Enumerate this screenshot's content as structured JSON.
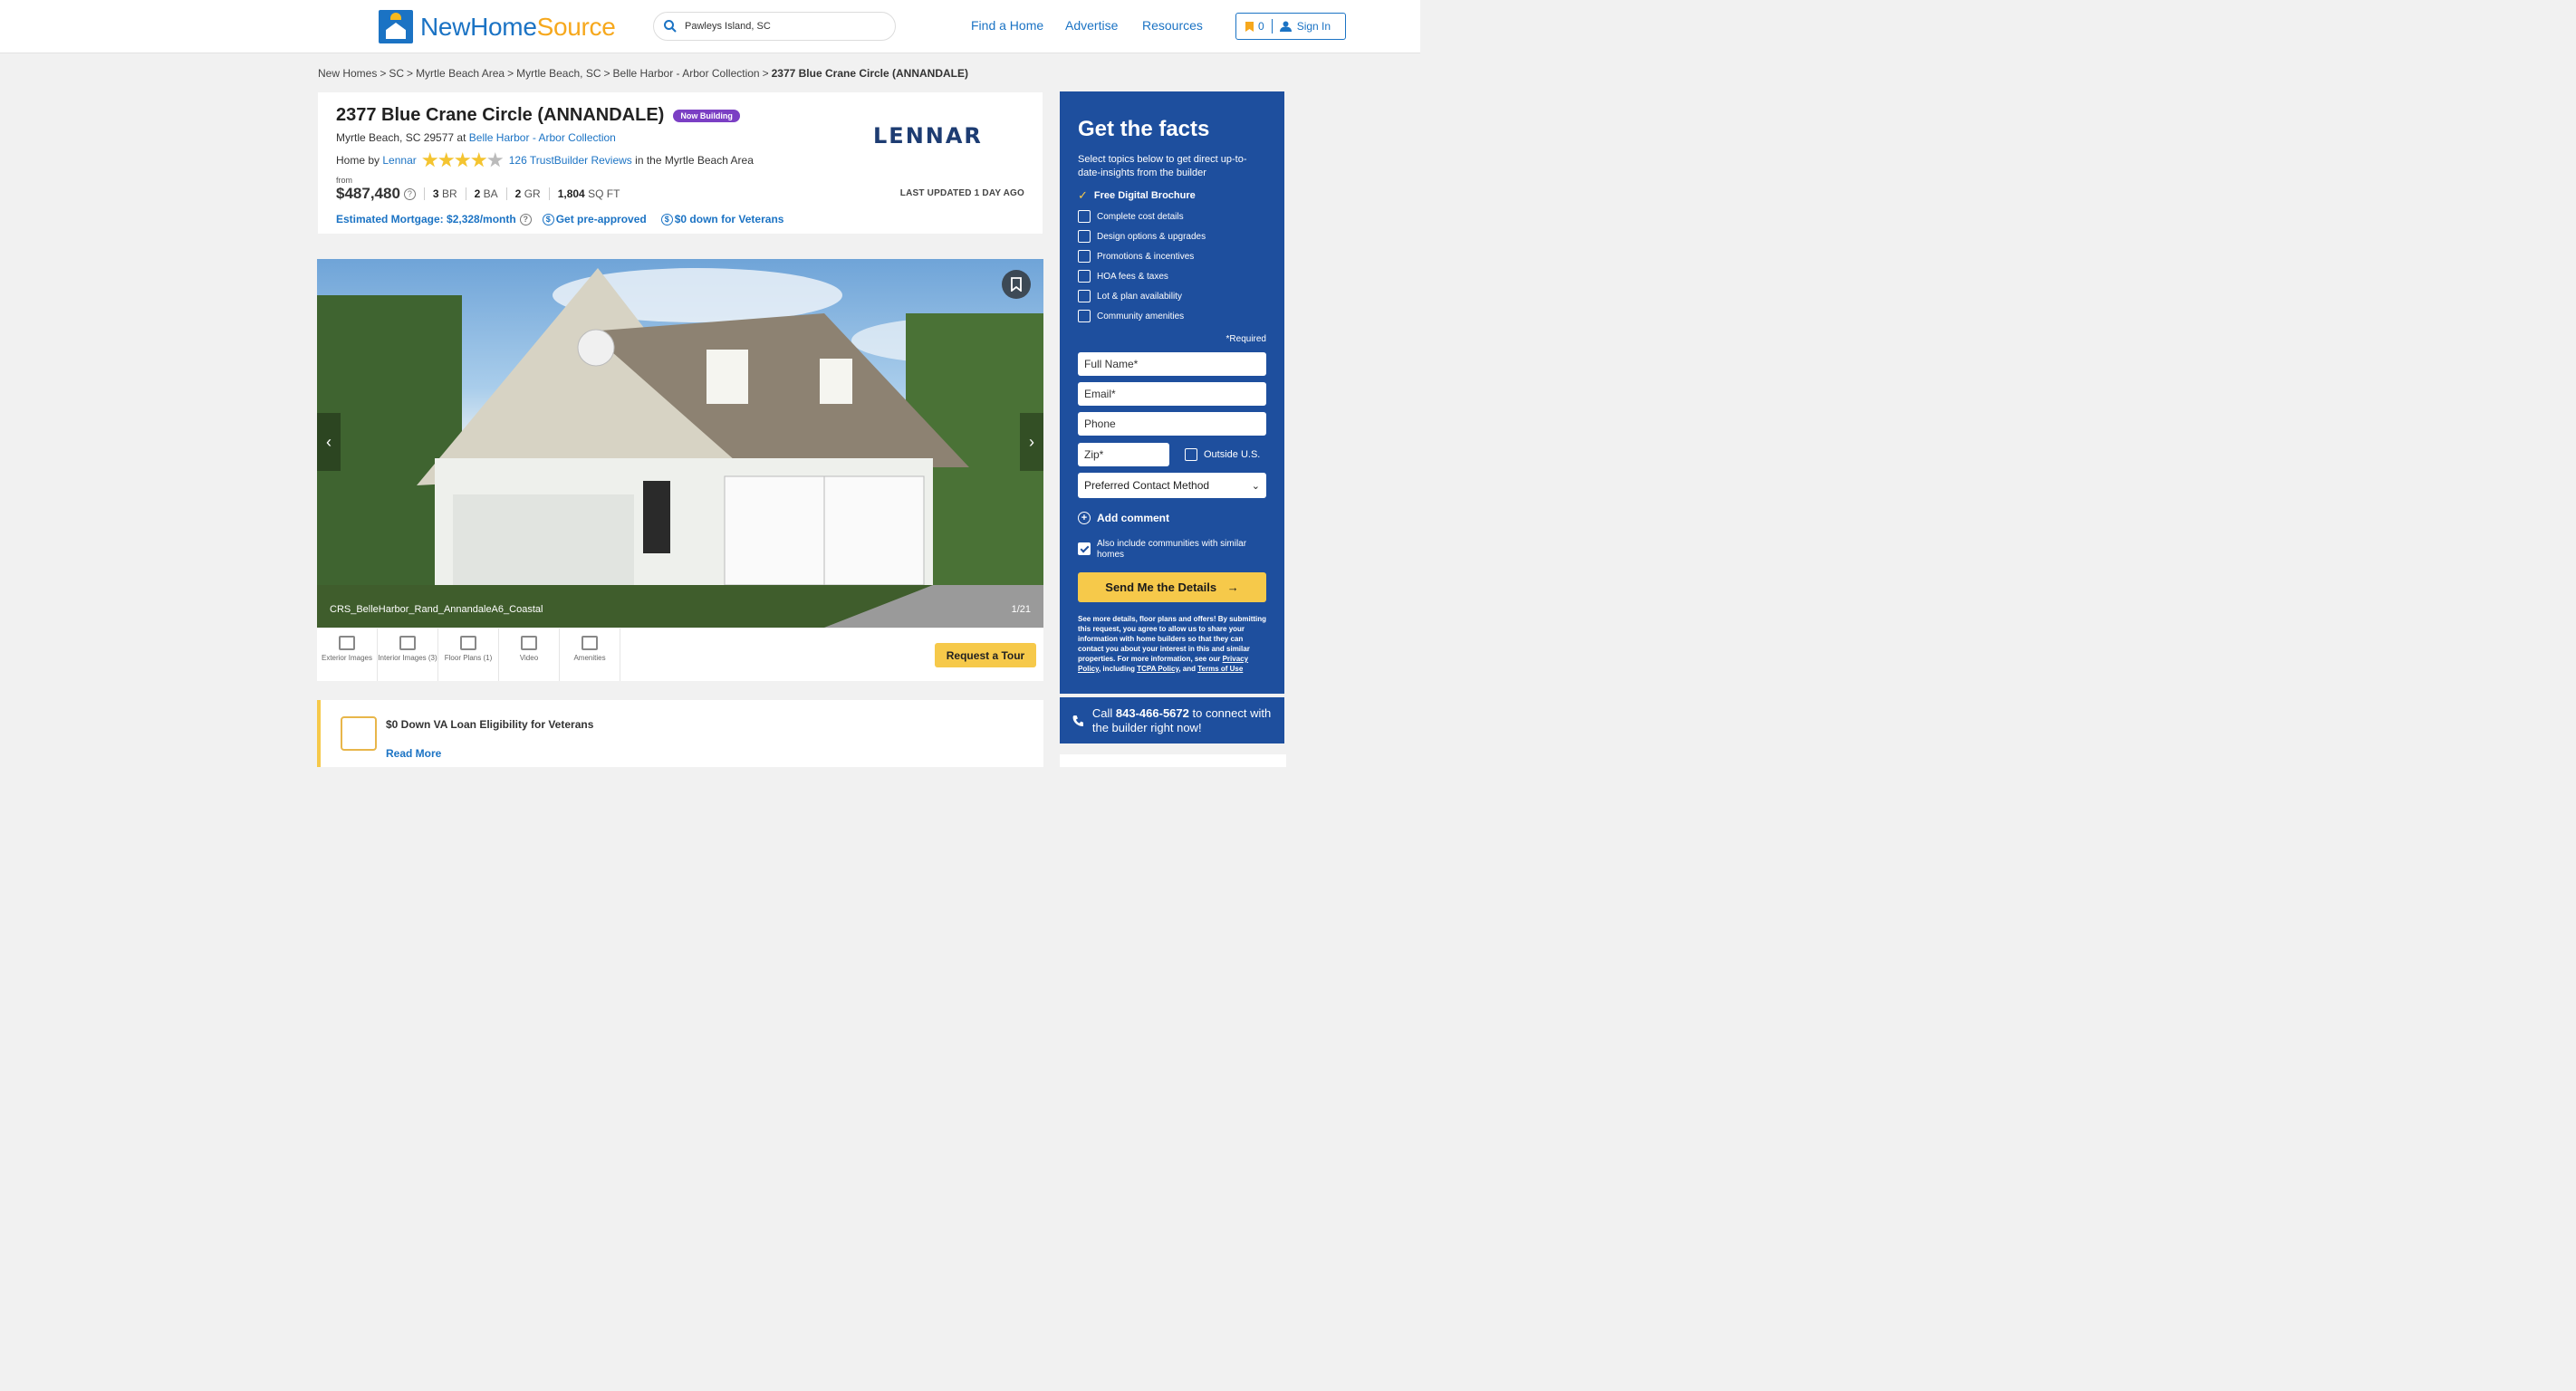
{
  "header": {
    "logo_part1": "NewHome",
    "logo_part2": "Source",
    "search_value": "Pawleys Island, SC",
    "nav": [
      "Find a Home",
      "Advertise",
      "Resources"
    ],
    "saved_count": "0",
    "sign_in": "Sign In",
    "colors": {
      "brand_blue": "#1b73c4",
      "brand_orange": "#f6a81d"
    }
  },
  "breadcrumb": [
    "New Homes",
    "SC",
    "Myrtle Beach Area",
    "Myrtle Beach, SC",
    "Belle Harbor - Arbor Collection",
    "2377 Blue Crane Circle (ANNANDALE)"
  ],
  "summary": {
    "title": "2377 Blue Crane Circle (ANNANDALE)",
    "badge": "Now Building",
    "address": "Myrtle Beach, SC 29577",
    "at": "at",
    "community": "Belle Harbor - Arbor Collection",
    "home_by": "Home by",
    "builder": "Lennar",
    "rating_stars": 4,
    "reviews": "126 TrustBuilder Reviews",
    "reviews_suffix": "in the Myrtle Beach Area",
    "from": "from",
    "price": "$487,480",
    "beds_num": "3",
    "beds_unit": "BR",
    "baths_num": "2",
    "baths_unit": "BA",
    "garage_num": "2",
    "garage_unit": "GR",
    "sqft_num": "1,804",
    "sqft_unit": "SQ FT",
    "updated_label": "LAST UPDATED",
    "updated_value": "1 DAY AGO",
    "builder_logo": "LENNAR",
    "mortgage": "Estimated Mortgage: $2,328/month",
    "preapproved": "Get pre-approved",
    "veterans": "$0 down for Veterans"
  },
  "gallery": {
    "caption": "CRS_BelleHarbor_Rand_AnnandaleA6_Coastal",
    "counter": "1/21",
    "tabs": [
      "Exterior Images",
      "Interior Images (3)",
      "Floor Plans (1)",
      "Video",
      "Amenities"
    ],
    "tour_button": "Request a Tour"
  },
  "promo": {
    "title": "$0 Down VA Loan Eligibility for Veterans",
    "link": "Read More"
  },
  "sidebar": {
    "heading": "Get the facts",
    "subheading": "Select topics below to get direct up-to-date-insights from the builder",
    "free_item": "Free Digital Brochure",
    "options": [
      "Complete cost details",
      "Design options & upgrades",
      "Promotions & incentives",
      "HOA fees & taxes",
      "Lot & plan availability",
      "Community amenities"
    ],
    "required": "*Required",
    "full_name": "Full Name*",
    "email": "Email*",
    "phone": "Phone",
    "zip": "Zip*",
    "outside": "Outside U.S.",
    "contact_method": "Preferred Contact Method",
    "add_comment": "Add comment",
    "also_include": "Also include communities with similar homes",
    "send": "Send Me the Details",
    "legal_text": "See more details, floor plans and offers! By submitting this request, you agree to allow us to share your information with home builders so that they can contact you about your interest in this and similar properties. For more information, see our",
    "privacy": "Privacy Policy",
    "including": ", including",
    "tcpa": "TCPA Policy",
    "and": ", and",
    "terms": "Terms of Use",
    "call_prefix": "Call",
    "phone_number": "843-466-5672",
    "call_suffix": "to connect with the builder right now!",
    "colors": {
      "panel": "#1e4f9e",
      "cta": "#f6c94a"
    }
  }
}
